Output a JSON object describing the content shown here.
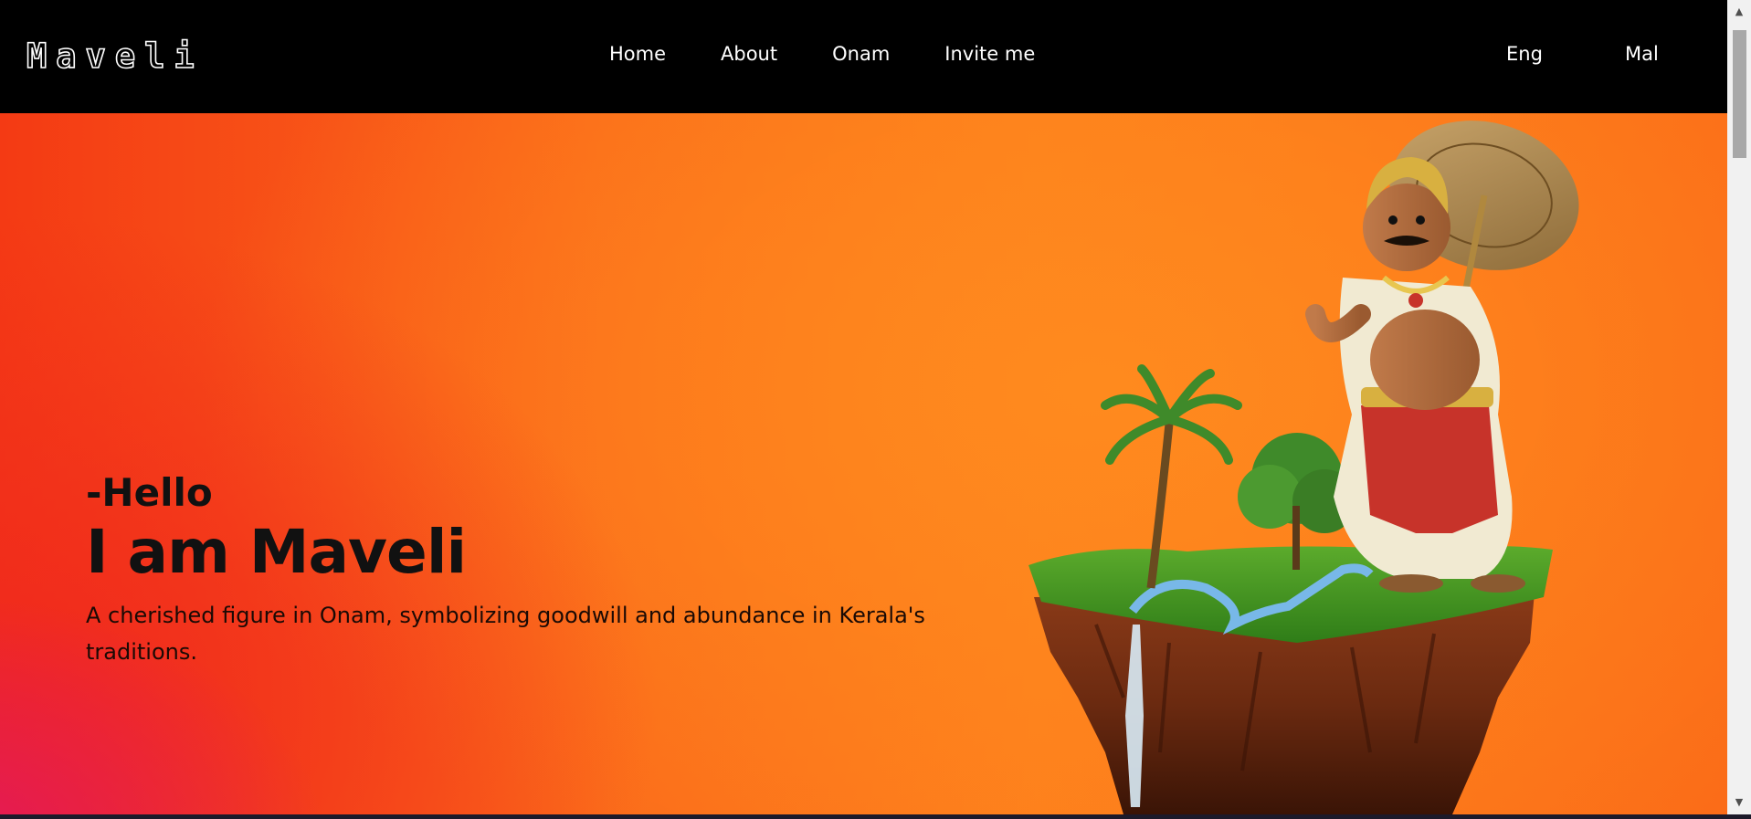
{
  "nav": {
    "logo": "Maveli",
    "links": [
      {
        "label": "Home"
      },
      {
        "label": "About"
      },
      {
        "label": "Onam"
      },
      {
        "label": "Invite me"
      }
    ],
    "lang_eng": "Eng",
    "lang_mal": "Mal"
  },
  "hero": {
    "greeting": "-Hello",
    "headline": "I am Maveli",
    "tagline": "A cherished figure in Onam, symbolizing goodwill and abundance in Kerala's traditions."
  },
  "colors": {
    "navbar_bg": "#000000",
    "hero_orange": "#fd7e1c",
    "hero_red": "#f0281e",
    "hero_pink": "#e3185a",
    "text_dark": "#111111"
  }
}
